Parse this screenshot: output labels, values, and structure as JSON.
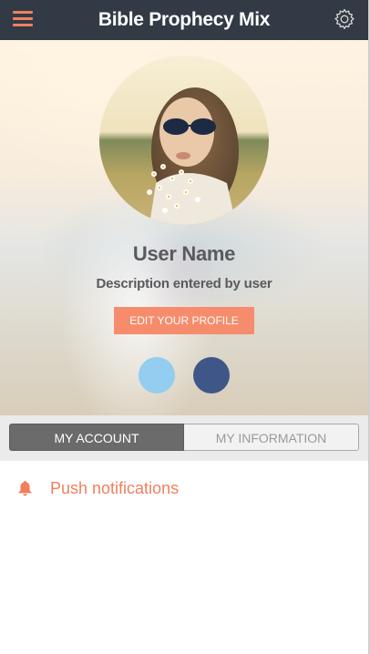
{
  "header": {
    "title": "Bible Prophecy Mix",
    "menu_icon": "hamburger-menu-icon",
    "settings_icon": "gear-icon"
  },
  "profile": {
    "user_name": "User Name",
    "description": "Description entered by user",
    "edit_button_label": "EDIT YOUR PROFILE",
    "social": [
      {
        "icon": "twitter-icon",
        "color": "#93cdef"
      },
      {
        "icon": "facebook-icon",
        "color": "#3f5688"
      }
    ]
  },
  "tabs": [
    {
      "label": "MY ACCOUNT",
      "selected": true
    },
    {
      "label": "MY INFORMATION",
      "selected": false
    }
  ],
  "settings": {
    "push_notifications_label": "Push notifications",
    "push_icon": "bell-icon"
  },
  "colors": {
    "nav_background": "#323a45",
    "accent": "#f07f5c",
    "button": "#f68c6c"
  }
}
